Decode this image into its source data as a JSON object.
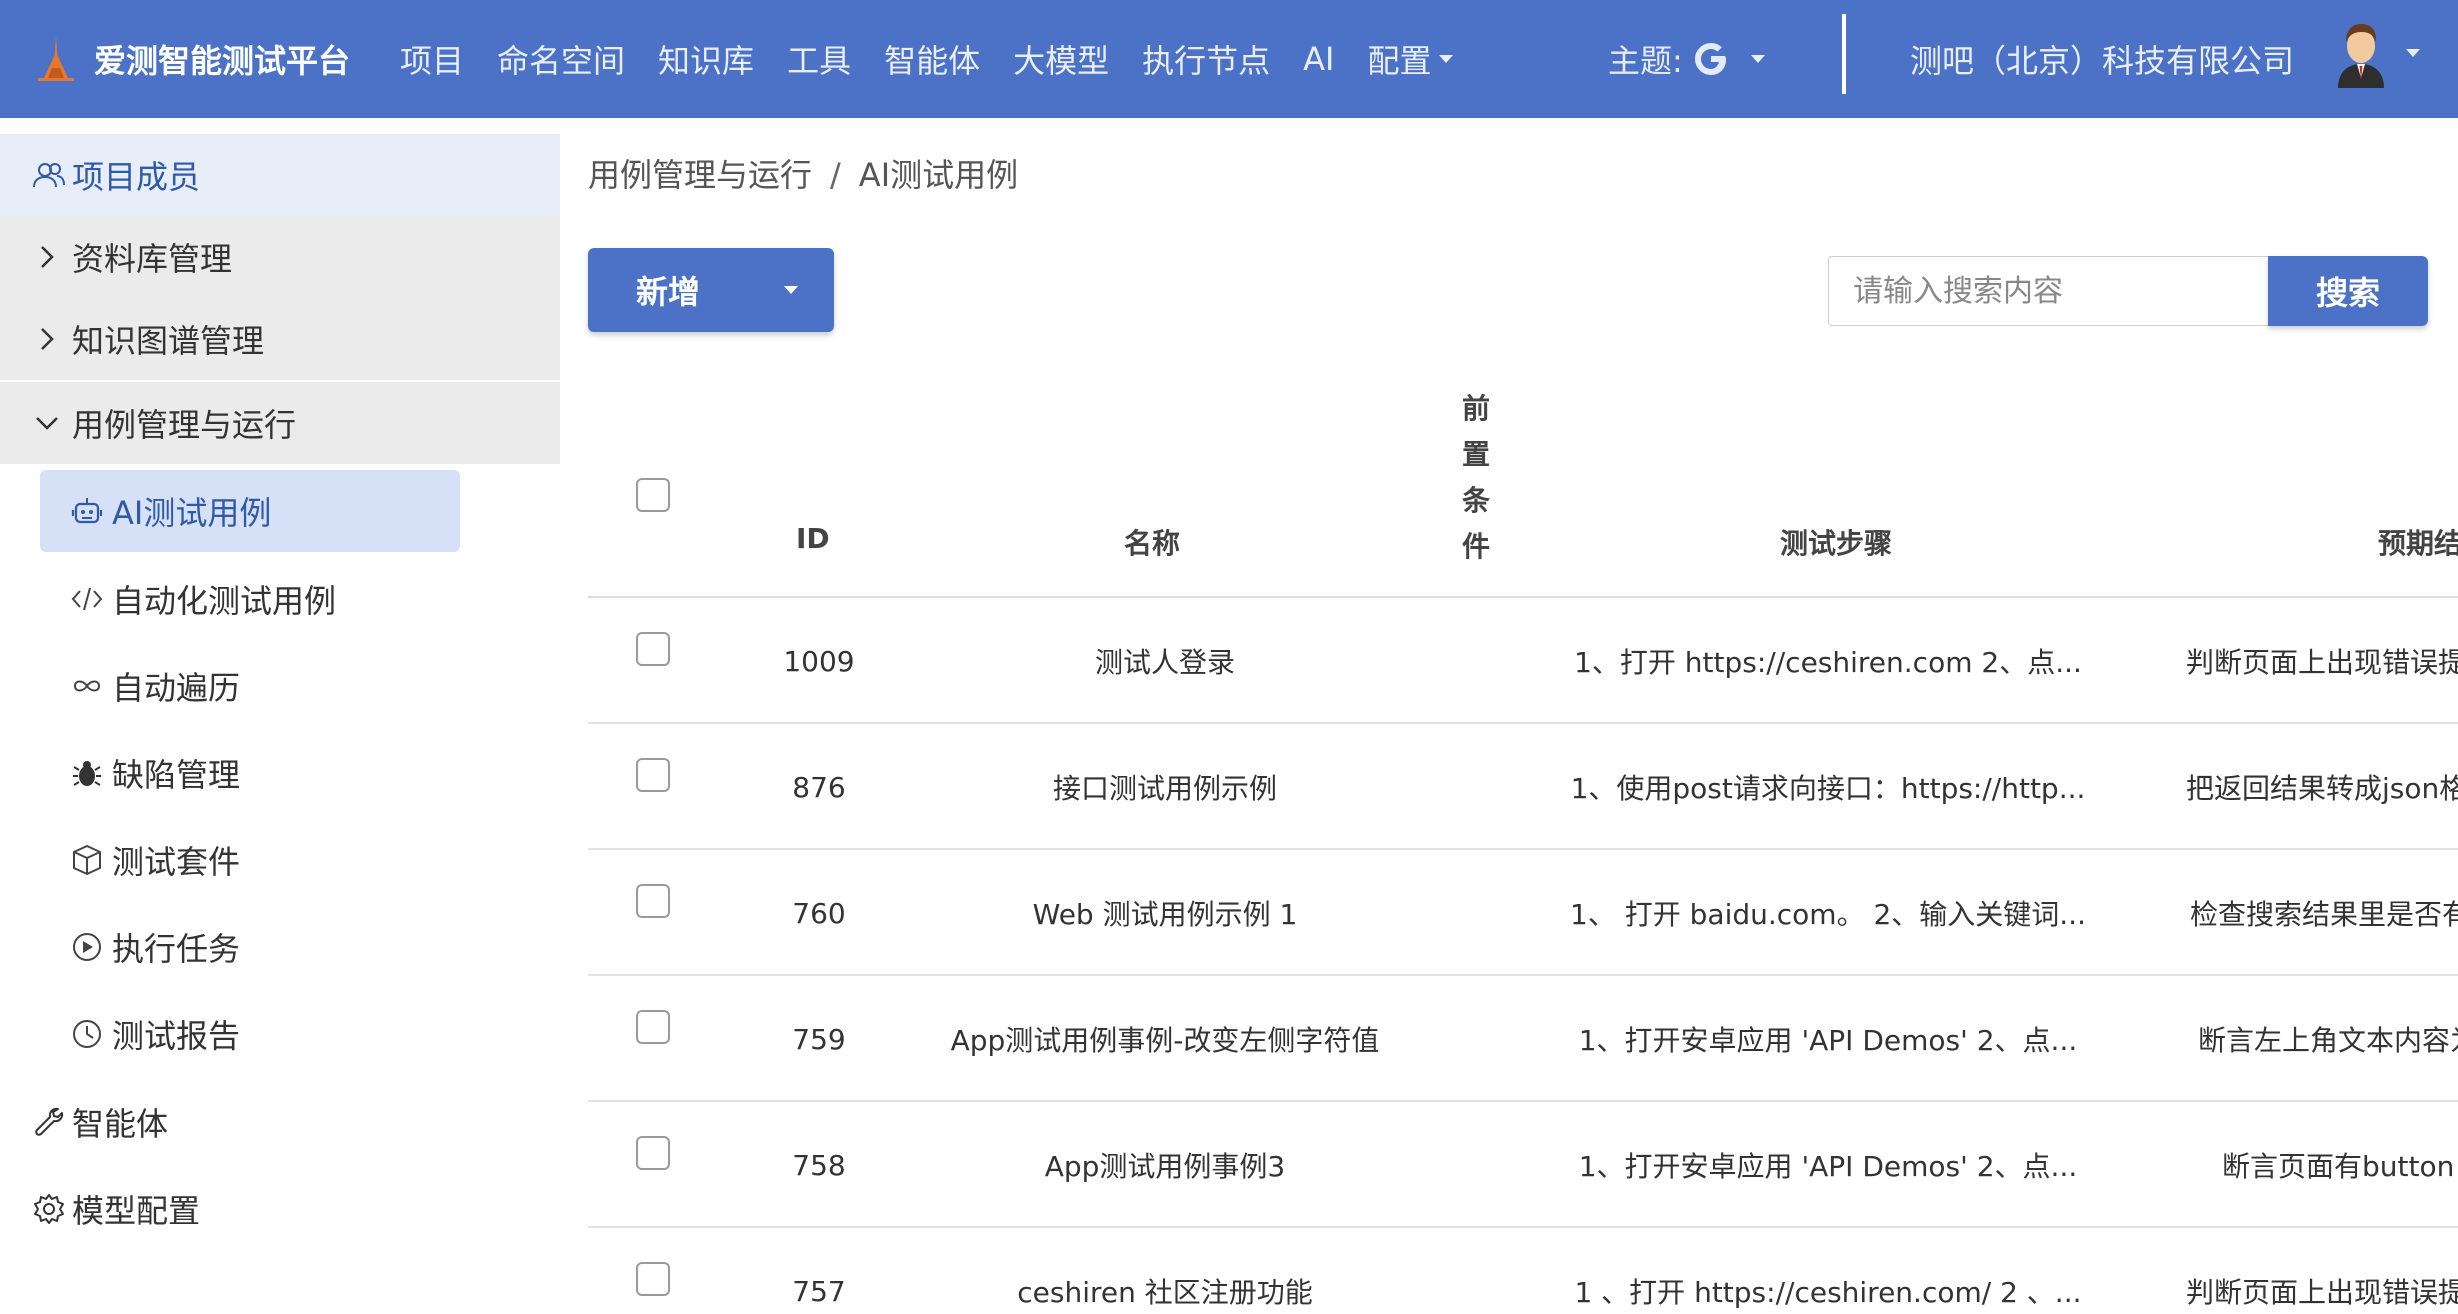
{
  "navbar": {
    "brand": "爱测智能测试平台",
    "menu": [
      "项目",
      "命名空间",
      "知识库",
      "工具",
      "智能体",
      "大模型",
      "执行节点",
      "AI"
    ],
    "config_label": "配置",
    "theme_label": "主题:",
    "company": "测吧（北京）科技有限公司",
    "accent_color": "#4b72c6"
  },
  "sidebar": {
    "top_item": "项目成员",
    "groups": [
      "资料库管理",
      "知识图谱管理",
      "用例管理与运行"
    ],
    "sub_items": [
      {
        "label": "AI测试用例",
        "icon": "robot-icon",
        "active": true
      },
      {
        "label": "自动化测试用例",
        "icon": "code-icon",
        "active": false
      },
      {
        "label": "自动遍历",
        "icon": "infinity-icon",
        "active": false
      },
      {
        "label": "缺陷管理",
        "icon": "bug-icon",
        "active": false
      },
      {
        "label": "测试套件",
        "icon": "box-icon",
        "active": false
      },
      {
        "label": "执行任务",
        "icon": "play-circle-icon",
        "active": false
      },
      {
        "label": "测试报告",
        "icon": "clock-icon",
        "active": false
      }
    ],
    "bottom_items": [
      {
        "label": "智能体",
        "icon": "wrench-icon"
      },
      {
        "label": "模型配置",
        "icon": "gear-icon"
      }
    ]
  },
  "breadcrumb": {
    "parent": "用例管理与运行",
    "separator": "/",
    "current": "AI测试用例"
  },
  "toolbar": {
    "add_label": "新增",
    "search_placeholder": "请输入搜索内容",
    "search_label": "搜索"
  },
  "table": {
    "headers": {
      "id": "ID",
      "name": "名称",
      "precondition": [
        "前",
        "置",
        "条",
        "件"
      ],
      "steps": "测试步骤",
      "expected": "预期结"
    },
    "rows": [
      {
        "id": "1009",
        "name": "测试人登录",
        "steps": "1、打开 https://ceshiren.com 2、点...",
        "expected": "判断页面上出现错误提"
      },
      {
        "id": "876",
        "name": "接口测试用例示例",
        "steps": "1、使用post请求向接口：https://http...",
        "expected": "把返回结果转成json格"
      },
      {
        "id": "760",
        "name": "Web 测试用例示例 1",
        "steps": "1、 打开 baidu.com。 2、输入关键词...",
        "expected": "检查搜索结果里是否有"
      },
      {
        "id": "759",
        "name": "App测试用例事例-改变左侧字符值",
        "steps": "1、打开安卓应用 'API Demos' 2、点...",
        "expected": "断言左上角文本内容为"
      },
      {
        "id": "758",
        "name": "App测试用例事例3",
        "steps": "1、打开安卓应用 'API Demos' 2、点...",
        "expected": "断言页面有button "
      },
      {
        "id": "757",
        "name": "ceshiren 社区注册功能",
        "steps": "1 、打开 https://ceshiren.com/ 2 、...",
        "expected": "判断页面上出现错误提"
      }
    ]
  }
}
